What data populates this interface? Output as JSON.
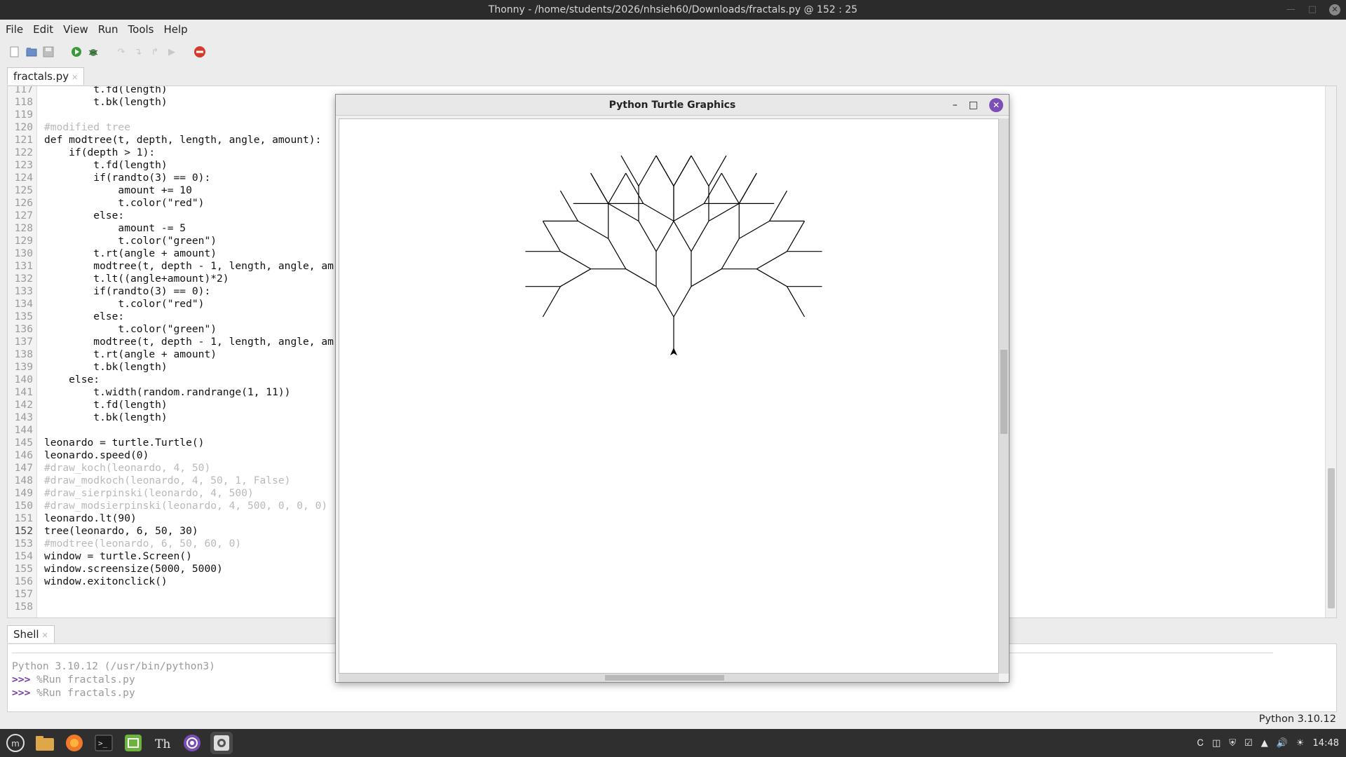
{
  "window": {
    "title": "Thonny  -  /home/students/2026/nhsieh60/Downloads/fractals.py  @  152 : 25"
  },
  "menu": [
    "File",
    "Edit",
    "View",
    "Run",
    "Tools",
    "Help"
  ],
  "toolbar": {
    "icons": [
      "new-file-icon",
      "open-file-icon",
      "save-file-icon",
      "run-icon",
      "debug-icon",
      "step-over-icon",
      "step-into-icon",
      "step-out-icon",
      "resume-icon",
      "stop-icon"
    ]
  },
  "editor": {
    "tab_label": "fractals.py",
    "current_line": 152,
    "lines": [
      {
        "n": "117",
        "text": "        t.fd(length)",
        "comment": false
      },
      {
        "n": "118",
        "text": "        t.bk(length)",
        "comment": false
      },
      {
        "n": "119",
        "text": "",
        "comment": false
      },
      {
        "n": "120",
        "text": "#modified tree",
        "comment": true
      },
      {
        "n": "121",
        "text": "def modtree(t, depth, length, angle, amount):",
        "comment": false
      },
      {
        "n": "122",
        "text": "    if(depth > 1):",
        "comment": false
      },
      {
        "n": "123",
        "text": "        t.fd(length)",
        "comment": false
      },
      {
        "n": "124",
        "text": "        if(randto(3) == 0):",
        "comment": false
      },
      {
        "n": "125",
        "text": "            amount += 10",
        "comment": false
      },
      {
        "n": "126",
        "text": "            t.color(\"red\")",
        "comment": false
      },
      {
        "n": "127",
        "text": "        else:",
        "comment": false
      },
      {
        "n": "128",
        "text": "            amount -= 5",
        "comment": false
      },
      {
        "n": "129",
        "text": "            t.color(\"green\")",
        "comment": false
      },
      {
        "n": "130",
        "text": "        t.rt(angle + amount)",
        "comment": false
      },
      {
        "n": "131",
        "text": "        modtree(t, depth - 1, length, angle, am",
        "comment": false
      },
      {
        "n": "132",
        "text": "        t.lt((angle+amount)*2)",
        "comment": false
      },
      {
        "n": "133",
        "text": "        if(randto(3) == 0):",
        "comment": false
      },
      {
        "n": "134",
        "text": "            t.color(\"red\")",
        "comment": false
      },
      {
        "n": "135",
        "text": "        else:",
        "comment": false
      },
      {
        "n": "136",
        "text": "            t.color(\"green\")",
        "comment": false
      },
      {
        "n": "137",
        "text": "        modtree(t, depth - 1, length, angle, am",
        "comment": false
      },
      {
        "n": "138",
        "text": "        t.rt(angle + amount)",
        "comment": false
      },
      {
        "n": "139",
        "text": "        t.bk(length)",
        "comment": false
      },
      {
        "n": "140",
        "text": "    else:",
        "comment": false
      },
      {
        "n": "141",
        "text": "        t.width(random.randrange(1, 11))",
        "comment": false
      },
      {
        "n": "142",
        "text": "        t.fd(length)",
        "comment": false
      },
      {
        "n": "143",
        "text": "        t.bk(length)",
        "comment": false
      },
      {
        "n": "144",
        "text": "",
        "comment": false
      },
      {
        "n": "145",
        "text": "leonardo = turtle.Turtle()",
        "comment": false
      },
      {
        "n": "146",
        "text": "leonardo.speed(0)",
        "comment": false
      },
      {
        "n": "147",
        "text": "#draw_koch(leonardo, 4, 50)",
        "comment": true
      },
      {
        "n": "148",
        "text": "#draw_modkoch(leonardo, 4, 50, 1, False)",
        "comment": true
      },
      {
        "n": "149",
        "text": "#draw_sierpinski(leonardo, 4, 500)",
        "comment": true
      },
      {
        "n": "150",
        "text": "#draw_modsierpinski(leonardo, 4, 500, 0, 0, 0)",
        "comment": true
      },
      {
        "n": "151",
        "text": "leonardo.lt(90)",
        "comment": false
      },
      {
        "n": "152",
        "text": "tree(leonardo, 6, 50, 30)",
        "comment": false
      },
      {
        "n": "153",
        "text": "#modtree(leonardo, 6, 50, 60, 0)",
        "comment": true
      },
      {
        "n": "154",
        "text": "window = turtle.Screen()",
        "comment": false
      },
      {
        "n": "155",
        "text": "window.screensize(5000, 5000)",
        "comment": false
      },
      {
        "n": "156",
        "text": "window.exitonclick()",
        "comment": false
      },
      {
        "n": "157",
        "text": "",
        "comment": false
      },
      {
        "n": "158",
        "text": "",
        "comment": false
      }
    ]
  },
  "shell": {
    "tab_label": "Shell",
    "version_line": "Python 3.10.12 (/usr/bin/python3)",
    "prompt": ">>>",
    "commands": [
      "%Run fractals.py",
      "%Run fractals.py"
    ]
  },
  "status": {
    "interpreter": "Python 3.10.12"
  },
  "turtle_window": {
    "title": "Python Turtle Graphics",
    "tree": {
      "depth": 6,
      "length": 50,
      "angle": 30,
      "heading": 90
    }
  },
  "taskbar": {
    "apps": [
      "menu-icon",
      "files-icon",
      "firefox-icon",
      "terminal-icon",
      "mint-update-icon",
      "thonny-icon",
      "tor-icon",
      "settings-icon"
    ],
    "clock": "14:48"
  }
}
